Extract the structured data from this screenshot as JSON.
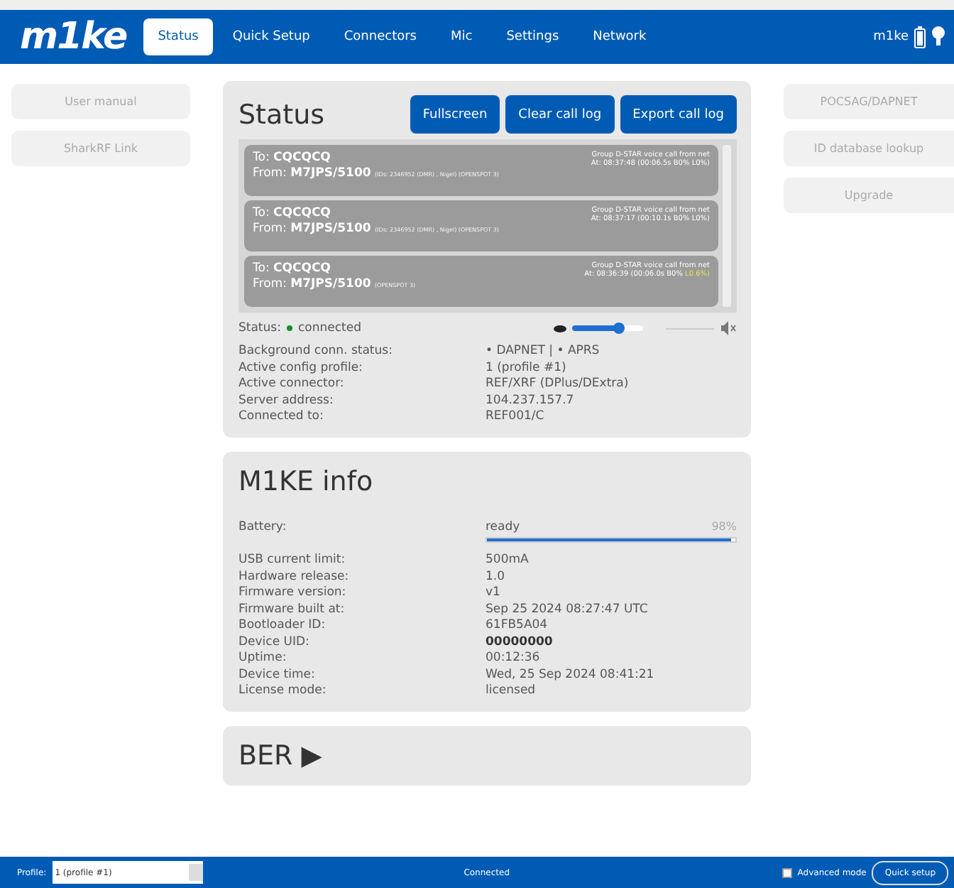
{
  "header": {
    "logo": "m1ke",
    "tabs": [
      {
        "label": "Status",
        "selected": true
      },
      {
        "label": "Quick Setup",
        "selected": false
      },
      {
        "label": "Connectors",
        "selected": false
      },
      {
        "label": "Mic",
        "selected": false
      },
      {
        "label": "Settings",
        "selected": false
      },
      {
        "label": "Network",
        "selected": false
      }
    ],
    "device": "m1ke"
  },
  "left_links": [
    "User manual",
    "SharkRF Link"
  ],
  "right_links": [
    "POCSAG/DAPNET",
    "ID database lookup",
    "Upgrade"
  ],
  "status": {
    "title": "Status",
    "buttons": [
      "Fullscreen",
      "Clear call log",
      "Export call log"
    ],
    "calls": [
      {
        "to_label": "To:",
        "to": "CQCQCQ",
        "from_label": "From:",
        "from": "M7JPS/5100",
        "details": "(IDs: 2346952 (DMR) , Nigel) (OPENSPOT 3)",
        "type": "Group D-STAR voice call from net",
        "time": "At: 08:37:48 (00:06.5s B0%",
        "loss": "L0%)",
        "loss_warning": false
      },
      {
        "to_label": "To:",
        "to": "CQCQCQ",
        "from_label": "From:",
        "from": "M7JPS/5100",
        "details": "(IDs: 2346952 (DMR) , Nigel) (OPENSPOT 3)",
        "type": "Group D-STAR voice call from net",
        "time": "At: 08:37:17 (00:10.1s B0%",
        "loss": "L0%)",
        "loss_warning": false
      },
      {
        "to_label": "To:",
        "to": "CQCQCQ",
        "from_label": "From:",
        "from": "M7JPS/5100",
        "details": "(OPENSPOT 3)",
        "type": "Group D-STAR voice call from net",
        "time": "At: 08:36:39 (00:06.0s B0%",
        "loss": "L0.6%)",
        "loss_warning": true
      }
    ],
    "connection_label": "Status:",
    "connection": "connected",
    "connected": true,
    "volume": {
      "level": 0.65
    },
    "muted": true,
    "rows": [
      {
        "label": "Background conn. status:",
        "value": "• DAPNET | • APRS"
      },
      {
        "label": "Active config profile:",
        "value": "1 (profile #1)"
      },
      {
        "label": "Active connector:",
        "value": "REF/XRF (DPlus/DExtra)"
      },
      {
        "label": "Server address:",
        "value": "104.237.157.7"
      },
      {
        "label": "Connected to:",
        "value": "REF001/C"
      }
    ]
  },
  "info": {
    "title": "M1KE info",
    "battery": {
      "label": "Battery:",
      "value": "ready",
      "percent": "98%",
      "level": 0.98
    },
    "rows": [
      {
        "label": "USB current limit:",
        "value": "500mA",
        "bold": false
      },
      {
        "label": "Hardware release:",
        "value": "1.0",
        "bold": false
      },
      {
        "label": "Firmware version:",
        "value": "v1",
        "bold": false
      },
      {
        "label": "Firmware built at:",
        "value": "Sep 25 2024 08:27:47 UTC",
        "bold": false
      },
      {
        "label": "Bootloader ID:",
        "value": "61FB5A04",
        "bold": false
      },
      {
        "label": "Device UID:",
        "value": "00000000",
        "bold": true
      },
      {
        "label": "Uptime:",
        "value": "00:12:36",
        "bold": false
      },
      {
        "label": "Device time:",
        "value": "Wed, 25 Sep 2024 08:41:21",
        "bold": false
      },
      {
        "label": "License mode:",
        "value": "licensed",
        "bold": false
      }
    ]
  },
  "ber": {
    "title": "BER ▶"
  },
  "footer": {
    "profile_label": "Profile:",
    "profile": "1 (profile #1)",
    "status": "Connected",
    "advanced_label": "Advanced mode",
    "advanced": false,
    "button": "Quick setup"
  }
}
